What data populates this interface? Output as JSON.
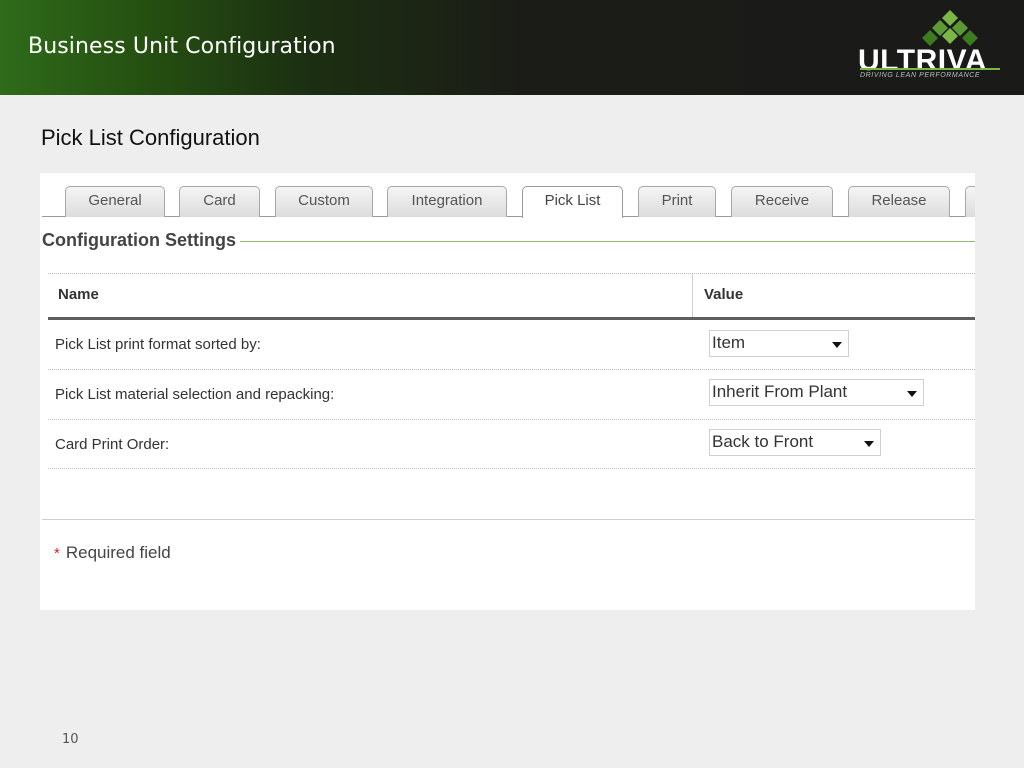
{
  "slide": {
    "title": "Business Unit Configuration",
    "subtitle": "Pick List Configuration",
    "page_number": "10"
  },
  "logo": {
    "wordmark": "ULTRIVA",
    "tagline": "DRIVING LEAN PERFORMANCE",
    "colors": {
      "green": "#7ab648",
      "dark_green": "#3e7a22"
    }
  },
  "tabs": [
    {
      "label": "General",
      "active": false
    },
    {
      "label": "Card",
      "active": false
    },
    {
      "label": "Custom",
      "active": false
    },
    {
      "label": "Integration",
      "active": false
    },
    {
      "label": "Pick List",
      "active": true
    },
    {
      "label": "Print",
      "active": false
    },
    {
      "label": "Receive",
      "active": false
    },
    {
      "label": "Release",
      "active": false
    }
  ],
  "section": {
    "title": "Configuration Settings"
  },
  "table": {
    "columns": [
      "Name",
      "Value"
    ],
    "rows": [
      {
        "name": "Pick List print format sorted by:",
        "value": "Item"
      },
      {
        "name": "Pick List material selection and repacking:",
        "value": "Inherit From Plant"
      },
      {
        "name": "Card Print Order:",
        "value": "Back to Front"
      }
    ]
  },
  "footer": {
    "required_marker": "*",
    "required_text": "Required field"
  },
  "colors": {
    "header_green": "#2f6b1a",
    "header_dark": "#1a1a18",
    "required_star": "#d21f1f",
    "section_rule": "#8fbc6a"
  }
}
